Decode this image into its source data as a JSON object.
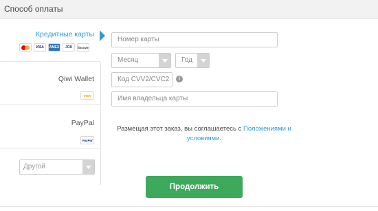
{
  "header": {
    "title": "Способ оплаты"
  },
  "methods": {
    "card": {
      "label": "Кредитные карты",
      "logos": [
        "MC",
        "VISA",
        "AMEX",
        "JCB",
        "discover"
      ]
    },
    "qiwi": {
      "label": "Qiwi Wallet",
      "logo_text": "VISA"
    },
    "paypal": {
      "label": "PayPal",
      "logo_text": "PayPal"
    },
    "other": {
      "selected": "Другой"
    }
  },
  "form": {
    "card_number_placeholder": "Номер карты",
    "month_placeholder": "Месяц",
    "year_placeholder": "Год",
    "cvv_placeholder": "Код CVV2/CVC2",
    "holder_placeholder": "Имя владельца карты",
    "info_icon": "i"
  },
  "terms": {
    "text_before": "Размещая этот заказ, вы соглашаетесь с ",
    "link_text": "Положениями и условиями",
    "text_after": "."
  },
  "actions": {
    "continue_label": "Продолжить"
  },
  "colors": {
    "accent": "#2a9dd8",
    "button": "#3daa5b"
  }
}
